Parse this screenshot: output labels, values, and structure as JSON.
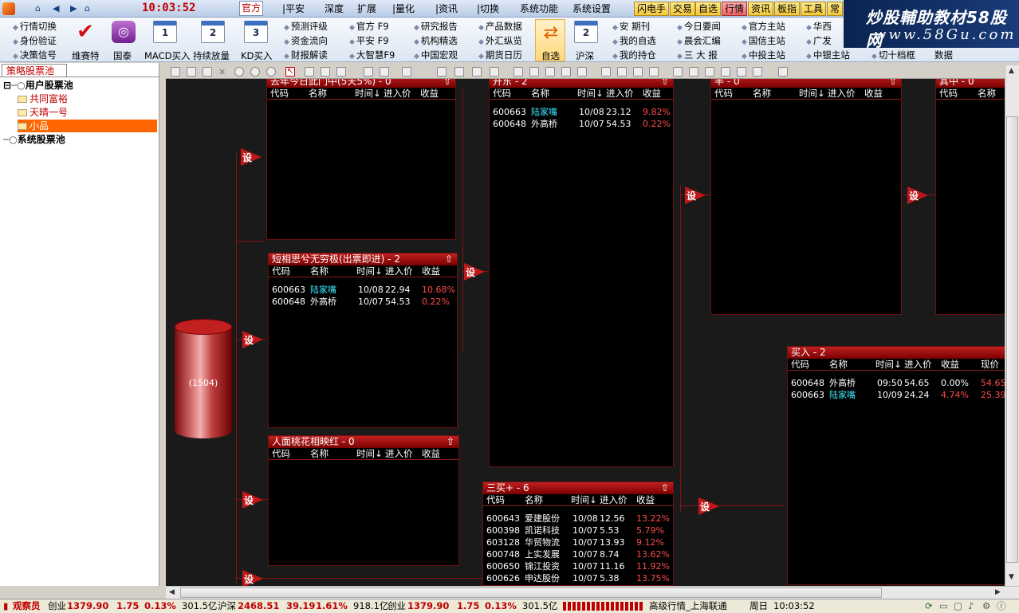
{
  "clock": "10:03:52",
  "menu": [
    "官方",
    "|平安",
    "深度",
    "扩展",
    "|量化",
    "|资讯",
    "|切换",
    "系统功能",
    "系统设置"
  ],
  "right_tabs": [
    "闪电手",
    "交易",
    "自选",
    "行情",
    "资讯",
    "板指",
    "工具",
    "常"
  ],
  "watermark": {
    "line1": "炒股輔助教材58股网",
    "line2": "www.58Gu.com"
  },
  "toolbar": {
    "col1": [
      "行情切换",
      "身份验证",
      "决策信号"
    ],
    "big_buttons": [
      {
        "label": "维赛特",
        "icon": "check-icon"
      },
      {
        "label": "国泰",
        "icon": "target-icon"
      },
      {
        "label": "MACD买入",
        "icon": "calendar-1-icon",
        "num": "1"
      },
      {
        "label": "持续放量",
        "icon": "calendar-2-icon",
        "num": "2"
      },
      {
        "label": "KD买入",
        "icon": "calendar-3-icon",
        "num": "3"
      }
    ],
    "col2": [
      "预测评级",
      "资金流向",
      "财报解读"
    ],
    "col3": [
      "官方    F9",
      "平安    F9",
      "大智慧F9"
    ],
    "col4": [
      "研究报告",
      "机构精选",
      "中国宏观"
    ],
    "col5": [
      "产品数据",
      "外汇纵览",
      "期货日历"
    ],
    "zixuan": "自选",
    "hushen": {
      "label": "沪深",
      "num": "2"
    },
    "col6": [
      "安",
      "我的自选",
      "我的持仓"
    ],
    "col6_extra": "期刊",
    "col7": [
      "今日要闻",
      "晨会汇编",
      "三 大 报"
    ],
    "col8": [
      "官方主站",
      "国信主站",
      "中投主站"
    ],
    "col9": [
      "华西",
      "广发",
      "中银主站"
    ],
    "extra": [
      "切十档框",
      "数据"
    ]
  },
  "left_panel": {
    "tab": "策略股票池",
    "tree": [
      {
        "label": "用户股票池",
        "type": "root"
      },
      {
        "label": "共同富裕",
        "type": "folder"
      },
      {
        "label": "天晴一号",
        "type": "folder"
      },
      {
        "label": "小品",
        "type": "folder-selected"
      },
      {
        "label": "系统股票池",
        "type": "root"
      }
    ]
  },
  "cylinder_label": "(1504)",
  "columns_std": [
    "代码",
    "名称",
    "时间↓",
    "进入价",
    "收益"
  ],
  "columns_buy": [
    "代码",
    "名称",
    "时间↓",
    "进入价",
    "收益",
    "现价"
  ],
  "flag_label": "设",
  "pools": {
    "p1": {
      "title": "去年今日此门中(5天5%) - 0",
      "rows": []
    },
    "p2": {
      "title": "短相思兮无穷极(出票即进) - 2",
      "rows": [
        [
          "600663",
          "陆家嘴",
          "10/08",
          "22.94",
          "10.68%"
        ],
        [
          "600648",
          "外高桥",
          "10/07",
          "54.53",
          "0.22%"
        ]
      ]
    },
    "p3": {
      "title": "人面桃花相映红 - 0",
      "rows": []
    },
    "p4": {
      "title": "开东 - 2",
      "rows": [
        [
          "600663",
          "陆家嘴",
          "10/08",
          "23.12",
          "9.82%"
        ],
        [
          "600648",
          "外高桥",
          "10/07",
          "54.53",
          "0.22%"
        ]
      ]
    },
    "p5": {
      "title": "三买+ - 6",
      "rows": [
        [
          "600643",
          "爱建股份",
          "10/08",
          "12.56",
          "13.22%"
        ],
        [
          "600398",
          "凯诺科技",
          "10/07",
          "5.53",
          "5.79%"
        ],
        [
          "603128",
          "华贸物流",
          "10/07",
          "13.93",
          "9.12%"
        ],
        [
          "600748",
          "上实发展",
          "10/07",
          "8.74",
          "13.62%"
        ],
        [
          "600650",
          "锦江投资",
          "10/07",
          "11.16",
          "11.92%"
        ],
        [
          "600626",
          "申达股份",
          "10/07",
          "5.38",
          "13.75%"
        ]
      ]
    },
    "p6": {
      "title": "半 - 0",
      "rows": []
    },
    "p7": {
      "title": "买入 - 2",
      "rows": [
        [
          "600648",
          "外高桥",
          "09:50",
          "54.65",
          "0.00%",
          "54.65"
        ],
        [
          "600663",
          "陆家嘴",
          "10/09",
          "24.24",
          "4.74%",
          "25.39"
        ]
      ]
    },
    "p8": {
      "title": "其中 - 0",
      "rows": []
    }
  },
  "status": {
    "role": "观察员",
    "seg1": [
      "创业",
      "1379.90",
      "1.75",
      "0.13%",
      "301.5亿"
    ],
    "seg2": [
      "沪深",
      "2468.51",
      "39.19",
      "1.61%",
      "918.1亿"
    ],
    "seg3": [
      "创业",
      "1379.90",
      "1.75",
      "0.13%",
      "301.5亿"
    ],
    "feed": "高级行情_上海联通",
    "day": "周日",
    "time": "10:03:52"
  }
}
